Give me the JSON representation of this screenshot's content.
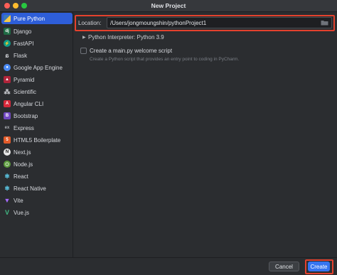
{
  "window": {
    "title": "New Project"
  },
  "sidebar": {
    "items": [
      {
        "label": "Pure Python",
        "icon": "python-icon",
        "selected": true
      },
      {
        "label": "Django",
        "icon": "django-icon"
      },
      {
        "label": "FastAPI",
        "icon": "fastapi-icon"
      },
      {
        "label": "Flask",
        "icon": "flask-icon"
      },
      {
        "label": "Google App Engine",
        "icon": "google-app-engine-icon"
      },
      {
        "label": "Pyramid",
        "icon": "pyramid-icon"
      },
      {
        "label": "Scientific",
        "icon": "scientific-icon"
      },
      {
        "label": "Angular CLI",
        "icon": "angular-icon"
      },
      {
        "label": "Bootstrap",
        "icon": "bootstrap-icon"
      },
      {
        "label": "Express",
        "icon": "express-icon"
      },
      {
        "label": "HTML5 Boilerplate",
        "icon": "html5-icon"
      },
      {
        "label": "Next.js",
        "icon": "nextjs-icon"
      },
      {
        "label": "Node.js",
        "icon": "nodejs-icon"
      },
      {
        "label": "React",
        "icon": "react-icon"
      },
      {
        "label": "React Native",
        "icon": "react-native-icon"
      },
      {
        "label": "Vite",
        "icon": "vite-icon"
      },
      {
        "label": "Vue.js",
        "icon": "vuejs-icon"
      }
    ]
  },
  "main": {
    "location_label": "Location:",
    "location_value": "/Users/jongmoungshin/pythonProject1",
    "interpreter_label": "Python Interpreter: Python 3.9",
    "welcome_checkbox_label": "Create a main.py welcome script",
    "welcome_checkbox_checked": false,
    "welcome_hint": "Create a Python script that provides an entry point to coding in PyCharm."
  },
  "footer": {
    "cancel_label": "Cancel",
    "create_label": "Create"
  },
  "colors": {
    "accent": "#3574f0",
    "selection": "#2e5ed8",
    "highlight": "#e4412d",
    "background": "#2b2d30"
  }
}
